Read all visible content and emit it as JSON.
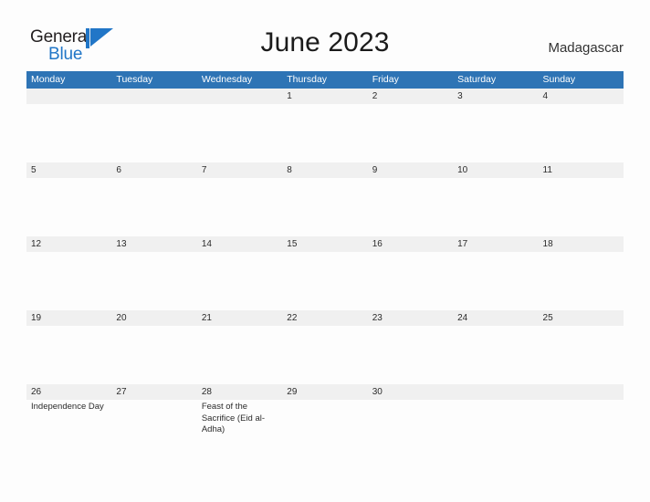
{
  "brand": {
    "word_one": "General",
    "word_two": "Blue",
    "flag_icon": "blue-flag-triangle",
    "color_dark": "#231f20",
    "color_blue": "#2176c7"
  },
  "header": {
    "title": "June 2023",
    "location": "Madagascar"
  },
  "theme": {
    "header_blue": "#2e74b5",
    "band_grey": "#f0f0f0",
    "page_background": "#fdfdfd"
  },
  "calendar": {
    "weekdays": [
      "Monday",
      "Tuesday",
      "Wednesday",
      "Thursday",
      "Friday",
      "Saturday",
      "Sunday"
    ],
    "weeks": [
      [
        {
          "date": "",
          "events": []
        },
        {
          "date": "",
          "events": []
        },
        {
          "date": "",
          "events": []
        },
        {
          "date": "1",
          "events": []
        },
        {
          "date": "2",
          "events": []
        },
        {
          "date": "3",
          "events": []
        },
        {
          "date": "4",
          "events": []
        }
      ],
      [
        {
          "date": "5",
          "events": []
        },
        {
          "date": "6",
          "events": []
        },
        {
          "date": "7",
          "events": []
        },
        {
          "date": "8",
          "events": []
        },
        {
          "date": "9",
          "events": []
        },
        {
          "date": "10",
          "events": []
        },
        {
          "date": "11",
          "events": []
        }
      ],
      [
        {
          "date": "12",
          "events": []
        },
        {
          "date": "13",
          "events": []
        },
        {
          "date": "14",
          "events": []
        },
        {
          "date": "15",
          "events": []
        },
        {
          "date": "16",
          "events": []
        },
        {
          "date": "17",
          "events": []
        },
        {
          "date": "18",
          "events": []
        }
      ],
      [
        {
          "date": "19",
          "events": []
        },
        {
          "date": "20",
          "events": []
        },
        {
          "date": "21",
          "events": []
        },
        {
          "date": "22",
          "events": []
        },
        {
          "date": "23",
          "events": []
        },
        {
          "date": "24",
          "events": []
        },
        {
          "date": "25",
          "events": []
        }
      ],
      [
        {
          "date": "26",
          "events": [
            "Independence Day"
          ]
        },
        {
          "date": "27",
          "events": []
        },
        {
          "date": "28",
          "events": [
            "Feast of the Sacrifice (Eid al-Adha)"
          ]
        },
        {
          "date": "29",
          "events": []
        },
        {
          "date": "30",
          "events": []
        },
        {
          "date": "",
          "events": []
        },
        {
          "date": "",
          "events": []
        }
      ]
    ]
  }
}
